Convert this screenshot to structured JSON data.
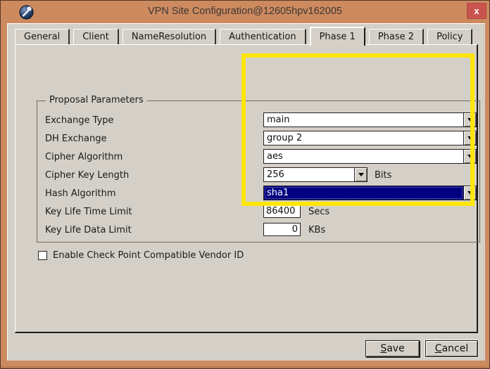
{
  "window": {
    "title": "VPN Site Configuration@12605hpv162005",
    "close_glyph": "x"
  },
  "tabs": [
    "General",
    "Client",
    "NameResolution",
    "Authentication",
    "Phase 1",
    "Phase 2",
    "Policy"
  ],
  "active_tab": "Phase 1",
  "phase1": {
    "group_title": "Proposal Parameters",
    "rows": [
      {
        "label": "Exchange Type",
        "value": "main"
      },
      {
        "label": "DH Exchange",
        "value": "group 2"
      },
      {
        "label": "Cipher Algorithm",
        "value": "aes"
      },
      {
        "label": "Cipher Key Length",
        "value": "256",
        "unit": "Bits"
      },
      {
        "label": "Hash Algorithm",
        "value": "sha1"
      },
      {
        "label": "Key Life Time Limit",
        "value": "86400",
        "unit": "Secs"
      },
      {
        "label": "Key Life Data Limit",
        "value": "0",
        "unit": "KBs"
      }
    ],
    "vendor_checkbox": {
      "label": "Enable Check Point Compatible Vendor ID",
      "checked": false
    }
  },
  "footer": {
    "save_label": "Save",
    "cancel_label": "Cancel"
  },
  "colors": {
    "frame_orange": "#cd8a5f",
    "dialog_gray": "#d4d0c8",
    "close_red": "#c9544e",
    "focus_navy": "#000080",
    "annotation_yellow": "#ffe606"
  }
}
